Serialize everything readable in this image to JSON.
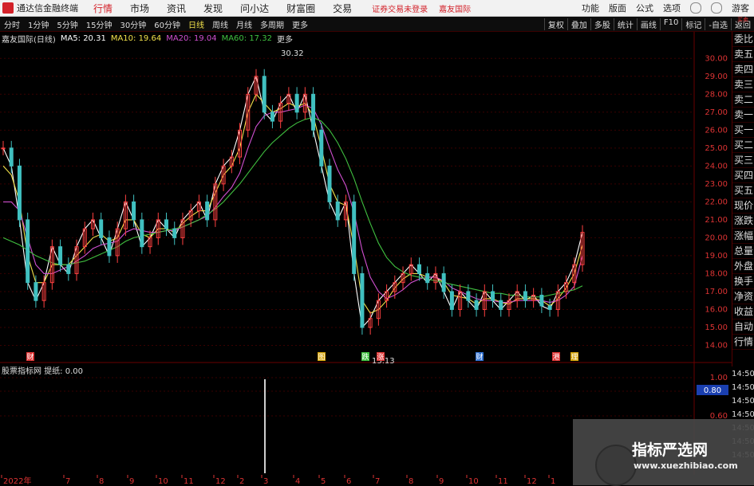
{
  "titlebar": {
    "app_name": "通达信金融终端",
    "menus": [
      "行情",
      "市场",
      "资讯",
      "发现",
      "问小达",
      "财富圈",
      "交易"
    ],
    "active_menu": "行情",
    "notice": "证券交易未登录",
    "stock_name": "嘉友国际",
    "right_items": [
      "功能",
      "版面",
      "公式",
      "选项"
    ],
    "user": "游客"
  },
  "periodbar": {
    "periods": [
      "分时",
      "1分钟",
      "5分钟",
      "15分钟",
      "30分钟",
      "60分钟",
      "日线",
      "周线",
      "月线",
      "多周期",
      "更多"
    ],
    "active_period": "日线",
    "tools": [
      "复权",
      "叠加",
      "多股",
      "统计",
      "画线",
      "F10",
      "标记",
      "-自选",
      "返回"
    ]
  },
  "indicator": {
    "stock": "嘉友国际(日线)",
    "ma5": "MA5: 20.31",
    "ma10": "MA10: 19.64",
    "ma20": "MA20: 19.04",
    "ma60": "MA60: 17.32"
  },
  "subchart": {
    "label": "股票指标网",
    "value": "提纸: 0.00",
    "y_ticks": [
      "1.00",
      "0.80",
      "0.60"
    ],
    "current": "0.80"
  },
  "right_panel": {
    "top": "买卖",
    "items": [
      "委比",
      "卖五",
      "卖四",
      "卖三",
      "卖二",
      "卖一",
      "买一",
      "买二",
      "买三",
      "买四",
      "买五",
      "现价",
      "涨跌",
      "涨幅",
      "总量",
      "外盘",
      "换手",
      "净资",
      "收益",
      "自动",
      "行情"
    ]
  },
  "right_times": [
    "14:50",
    "14:50",
    "14:50",
    "14:50",
    "14:50",
    "14:50",
    "14:50"
  ],
  "date_axis": [
    "2022年",
    "7",
    "8",
    "9",
    "10",
    "11",
    "12",
    "2",
    "3",
    "4",
    "5",
    "6",
    "7",
    "8",
    "9",
    "10",
    "11",
    "12",
    "1"
  ],
  "markers": [
    "财",
    "图",
    "跌",
    "涨",
    "财",
    "港",
    "理"
  ],
  "annotations": {
    "high": "30.32",
    "low": "13.13"
  },
  "watermark": {
    "title": "指标严选网",
    "url": "www.xuezhibiao.com"
  },
  "colors": {
    "accent": "#d3222a",
    "ma5": "#ffffff",
    "ma10": "#f0e04a",
    "ma20": "#d050d0",
    "ma60": "#40c040",
    "up": "#ff4040",
    "down": "#40c0c0"
  },
  "chart_data": {
    "type": "line",
    "ylim": [
      13,
      30.5
    ],
    "y_ticks": [
      14,
      15,
      16,
      17,
      18,
      19,
      20,
      21,
      22,
      23,
      24,
      25,
      26,
      27,
      28,
      29,
      30
    ],
    "series": [
      {
        "name": "MA5",
        "values": [
          25,
          24,
          21,
          17.5,
          16.5,
          17.5,
          19.5,
          18.5,
          18,
          19.5,
          20.5,
          21,
          20,
          19,
          20.5,
          22,
          21,
          19.5,
          20,
          21,
          20.5,
          20,
          21,
          21.5,
          22,
          21,
          23,
          24,
          24.5,
          26,
          28,
          29,
          27,
          26.5,
          27.5,
          28,
          27,
          28,
          26,
          24,
          22,
          21,
          22,
          18,
          15,
          15.5,
          16.5,
          17,
          17.5,
          18,
          18.5,
          18,
          17.5,
          18,
          17,
          16,
          17,
          16.5,
          16,
          17,
          16.5,
          16,
          16.5,
          17,
          16.5,
          16.8,
          16.2,
          16,
          17,
          17.5,
          18.5,
          20.3
        ]
      },
      {
        "name": "MA10",
        "values": [
          24,
          23.5,
          22,
          19,
          17.5,
          17.5,
          18.5,
          18.5,
          18.5,
          19,
          19.5,
          20,
          20.2,
          19.8,
          20,
          21,
          21,
          20.2,
          20,
          20.5,
          20.5,
          20.3,
          20.8,
          21.2,
          21.5,
          21.5,
          22.5,
          23.5,
          24,
          25,
          27,
          28,
          27.5,
          27,
          27.2,
          27.5,
          27.3,
          27.5,
          26.8,
          25,
          23,
          22,
          21.8,
          19.5,
          16.5,
          15.8,
          16,
          16.5,
          17.2,
          17.7,
          18,
          18,
          17.8,
          17.8,
          17.5,
          16.8,
          16.7,
          16.6,
          16.3,
          16.6,
          16.6,
          16.4,
          16.3,
          16.6,
          16.6,
          16.6,
          16.5,
          16.2,
          16.6,
          17.2,
          18,
          19.6
        ]
      },
      {
        "name": "MA20",
        "values": [
          22,
          22,
          21.5,
          20,
          18.5,
          18,
          18,
          18.2,
          18.4,
          18.7,
          19,
          19.4,
          19.6,
          19.7,
          19.8,
          20.3,
          20.5,
          20.4,
          20.3,
          20.3,
          20.4,
          20.4,
          20.6,
          20.8,
          21,
          21.2,
          21.7,
          22.3,
          22.8,
          23.6,
          25,
          26.2,
          26.8,
          27,
          27,
          27.1,
          27.2,
          27.4,
          27.2,
          26.3,
          25,
          23.8,
          22.9,
          21.4,
          19.3,
          17.8,
          17,
          16.6,
          16.8,
          17.1,
          17.5,
          17.7,
          17.8,
          17.8,
          17.6,
          17.2,
          17,
          16.8,
          16.6,
          16.5,
          16.5,
          16.4,
          16.4,
          16.5,
          16.5,
          16.5,
          16.5,
          16.4,
          16.5,
          16.8,
          17.3,
          19
        ]
      },
      {
        "name": "MA60",
        "values": [
          20,
          19.8,
          19.6,
          19.3,
          19,
          18.8,
          18.6,
          18.5,
          18.5,
          18.6,
          18.7,
          18.9,
          19.1,
          19.3,
          19.5,
          19.8,
          20,
          20.1,
          20.2,
          20.3,
          20.4,
          20.5,
          20.6,
          20.8,
          21,
          21.3,
          21.6,
          22,
          22.5,
          23,
          23.6,
          24.2,
          24.8,
          25.3,
          25.7,
          26.1,
          26.4,
          26.6,
          26.7,
          26.5,
          26,
          25.3,
          24.4,
          23.3,
          22,
          20.8,
          19.7,
          18.9,
          18.4,
          18.1,
          17.9,
          17.8,
          17.7,
          17.6,
          17.5,
          17.4,
          17.3,
          17.2,
          17.1,
          17,
          16.9,
          16.9,
          16.8,
          16.8,
          16.7,
          16.7,
          16.7,
          16.8,
          16.9,
          17,
          17.1,
          17.32
        ]
      }
    ]
  }
}
